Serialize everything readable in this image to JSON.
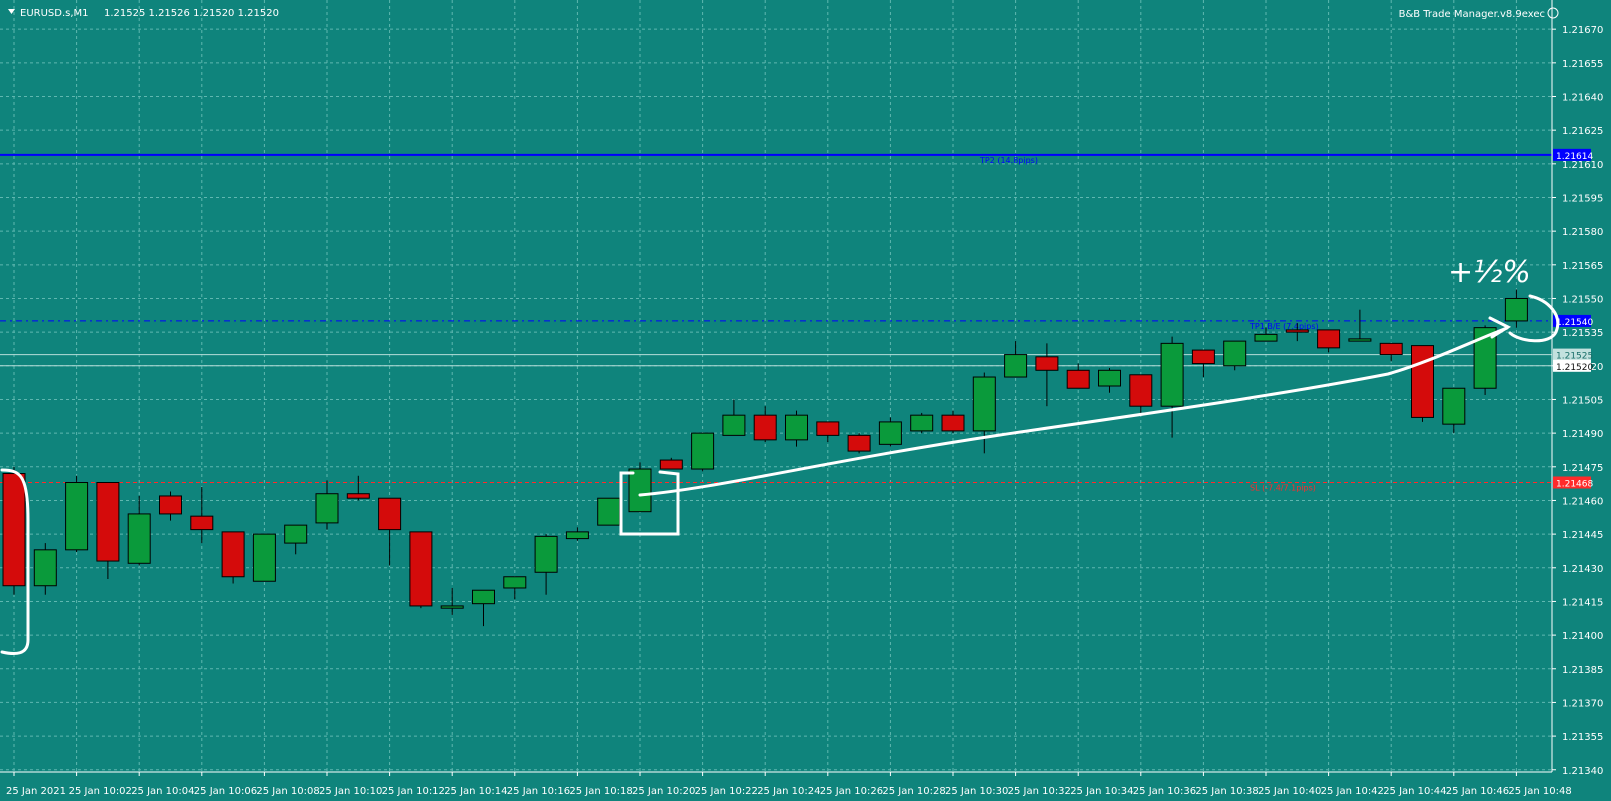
{
  "header": {
    "symbol": "EURUSD.s,M1",
    "ohlc": "1.21525 1.21526 1.21520 1.21520",
    "indicator": "B&B Trade Manager.v8.9exec"
  },
  "annotation": {
    "text": "+½%"
  },
  "colors": {
    "background": "#0f847c",
    "grid": "#5fb7b0",
    "bull": "#0a9a3b",
    "bear": "#d40b0b",
    "tp": "#0000ff",
    "sl": "#ff2a2a",
    "ink": "#ffffff"
  },
  "chart_data": {
    "type": "candlestick",
    "title": "",
    "xlabel": "",
    "ylabel": "",
    "ylim": [
      1.21339,
      1.21683
    ],
    "y_ticks": [
      "1.21670",
      "1.21655",
      "1.21640",
      "1.21625",
      "1.21610",
      "1.21595",
      "1.21580",
      "1.21565",
      "1.21550",
      "1.21535",
      "1.21520",
      "1.21505",
      "1.21490",
      "1.21475",
      "1.21460",
      "1.21445",
      "1.21430",
      "1.21415",
      "1.21400",
      "1.21385",
      "1.21370",
      "1.21355",
      "1.21340"
    ],
    "x_ticks": [
      {
        "i": 0,
        "label": "25 Jan 2021"
      },
      {
        "i": 2,
        "label": "25 Jan 10:02"
      },
      {
        "i": 4,
        "label": "25 Jan 10:04"
      },
      {
        "i": 6,
        "label": "25 Jan 10:06"
      },
      {
        "i": 8,
        "label": "25 Jan 10:08"
      },
      {
        "i": 10,
        "label": "25 Jan 10:10"
      },
      {
        "i": 12,
        "label": "25 Jan 10:12"
      },
      {
        "i": 14,
        "label": "25 Jan 10:14"
      },
      {
        "i": 16,
        "label": "25 Jan 10:16"
      },
      {
        "i": 18,
        "label": "25 Jan 10:18"
      },
      {
        "i": 20,
        "label": "25 Jan 10:20"
      },
      {
        "i": 22,
        "label": "25 Jan 10:22"
      },
      {
        "i": 24,
        "label": "25 Jan 10:24"
      },
      {
        "i": 26,
        "label": "25 Jan 10:26"
      },
      {
        "i": 28,
        "label": "25 Jan 10:28"
      },
      {
        "i": 30,
        "label": "25 Jan 10:30"
      },
      {
        "i": 32,
        "label": "25 Jan 10:32"
      },
      {
        "i": 34,
        "label": "25 Jan 10:34"
      },
      {
        "i": 36,
        "label": "25 Jan 10:36"
      },
      {
        "i": 38,
        "label": "25 Jan 10:38"
      },
      {
        "i": 40,
        "label": "25 Jan 10:40"
      },
      {
        "i": 42,
        "label": "25 Jan 10:42"
      },
      {
        "i": 44,
        "label": "25 Jan 10:44"
      },
      {
        "i": 46,
        "label": "25 Jan 10:46"
      },
      {
        "i": 48,
        "label": "25 Jan 10:48"
      }
    ],
    "candles": [
      {
        "o": 1.21472,
        "h": 1.21475,
        "l": 1.21418,
        "c": 1.21422
      },
      {
        "o": 1.21422,
        "h": 1.21441,
        "l": 1.21418,
        "c": 1.21438
      },
      {
        "o": 1.21438,
        "h": 1.21471,
        "l": 1.21437,
        "c": 1.21468
      },
      {
        "o": 1.21468,
        "h": 1.21468,
        "l": 1.21425,
        "c": 1.21433
      },
      {
        "o": 1.21432,
        "h": 1.21462,
        "l": 1.21431,
        "c": 1.21454
      },
      {
        "o": 1.21462,
        "h": 1.21464,
        "l": 1.21451,
        "c": 1.21454
      },
      {
        "o": 1.21453,
        "h": 1.21466,
        "l": 1.21441,
        "c": 1.21447
      },
      {
        "o": 1.21446,
        "h": 1.21446,
        "l": 1.21423,
        "c": 1.21426
      },
      {
        "o": 1.21424,
        "h": 1.21445,
        "l": 1.21424,
        "c": 1.21445
      },
      {
        "o": 1.21441,
        "h": 1.21448,
        "l": 1.21436,
        "c": 1.21449
      },
      {
        "o": 1.2145,
        "h": 1.21469,
        "l": 1.21447,
        "c": 1.21463
      },
      {
        "o": 1.21463,
        "h": 1.21471,
        "l": 1.2146,
        "c": 1.21461
      },
      {
        "o": 1.21461,
        "h": 1.21461,
        "l": 1.21431,
        "c": 1.21447
      },
      {
        "o": 1.21446,
        "h": 1.21446,
        "l": 1.21412,
        "c": 1.21413
      },
      {
        "o": 1.21412,
        "h": 1.21421,
        "l": 1.21409,
        "c": 1.21413
      },
      {
        "o": 1.21414,
        "h": 1.2142,
        "l": 1.21404,
        "c": 1.2142
      },
      {
        "o": 1.21421,
        "h": 1.21426,
        "l": 1.21416,
        "c": 1.21426
      },
      {
        "o": 1.21428,
        "h": 1.21445,
        "l": 1.21418,
        "c": 1.21444
      },
      {
        "o": 1.21443,
        "h": 1.21448,
        "l": 1.21442,
        "c": 1.21446
      },
      {
        "o": 1.21449,
        "h": 1.21457,
        "l": 1.21449,
        "c": 1.21461
      },
      {
        "o": 1.21455,
        "h": 1.21477,
        "l": 1.21455,
        "c": 1.21474
      },
      {
        "o": 1.21478,
        "h": 1.21479,
        "l": 1.21474,
        "c": 1.21474
      },
      {
        "o": 1.21474,
        "h": 1.21489,
        "l": 1.21473,
        "c": 1.2149
      },
      {
        "o": 1.21489,
        "h": 1.21505,
        "l": 1.21489,
        "c": 1.21498
      },
      {
        "o": 1.21498,
        "h": 1.21502,
        "l": 1.21486,
        "c": 1.21487
      },
      {
        "o": 1.21487,
        "h": 1.215,
        "l": 1.21484,
        "c": 1.21498
      },
      {
        "o": 1.21495,
        "h": 1.21495,
        "l": 1.21486,
        "c": 1.21489
      },
      {
        "o": 1.21489,
        "h": 1.2149,
        "l": 1.21481,
        "c": 1.21482
      },
      {
        "o": 1.21485,
        "h": 1.21497,
        "l": 1.21484,
        "c": 1.21495
      },
      {
        "o": 1.21491,
        "h": 1.21499,
        "l": 1.2149,
        "c": 1.21498
      },
      {
        "o": 1.21498,
        "h": 1.215,
        "l": 1.2149,
        "c": 1.21491
      },
      {
        "o": 1.21491,
        "h": 1.21517,
        "l": 1.21481,
        "c": 1.21515
      },
      {
        "o": 1.21515,
        "h": 1.21531,
        "l": 1.21515,
        "c": 1.21525
      },
      {
        "o": 1.21524,
        "h": 1.2153,
        "l": 1.21502,
        "c": 1.21518
      },
      {
        "o": 1.21518,
        "h": 1.21521,
        "l": 1.2151,
        "c": 1.2151
      },
      {
        "o": 1.21511,
        "h": 1.21519,
        "l": 1.21508,
        "c": 1.21518
      },
      {
        "o": 1.21516,
        "h": 1.21516,
        "l": 1.21498,
        "c": 1.21502
      },
      {
        "o": 1.21502,
        "h": 1.21533,
        "l": 1.21488,
        "c": 1.2153
      },
      {
        "o": 1.21527,
        "h": 1.21527,
        "l": 1.21515,
        "c": 1.21521
      },
      {
        "o": 1.2152,
        "h": 1.21531,
        "l": 1.21518,
        "c": 1.21531
      },
      {
        "o": 1.21531,
        "h": 1.21537,
        "l": 1.21531,
        "c": 1.21534
      },
      {
        "o": 1.21536,
        "h": 1.21539,
        "l": 1.21531,
        "c": 1.21535
      },
      {
        "o": 1.21536,
        "h": 1.21536,
        "l": 1.21526,
        "c": 1.21528
      },
      {
        "o": 1.21531,
        "h": 1.21545,
        "l": 1.21531,
        "c": 1.21532
      },
      {
        "o": 1.2153,
        "h": 1.2153,
        "l": 1.21522,
        "c": 1.21525
      },
      {
        "o": 1.21529,
        "h": 1.21529,
        "l": 1.21495,
        "c": 1.21497
      },
      {
        "o": 1.21494,
        "h": 1.21509,
        "l": 1.2149,
        "c": 1.2151
      },
      {
        "o": 1.2151,
        "h": 1.21538,
        "l": 1.21507,
        "c": 1.21537
      },
      {
        "o": 1.2154,
        "h": 1.21554,
        "l": 1.21537,
        "c": 1.2155
      }
    ],
    "levels": [
      {
        "name": "tp2",
        "price": 1.21614,
        "label": "TP2 (14.8pips)",
        "price_label": "1.21614"
      },
      {
        "name": "tp1",
        "price": 1.2154,
        "label": "TP1 B/E (7.4pips)",
        "price_label": "1.21540"
      },
      {
        "name": "sl",
        "price": 1.21468,
        "label": "SL (-7.4/7.1pips)",
        "price_label": "1.21468"
      },
      {
        "name": "ask",
        "price": 1.21525,
        "label": "",
        "price_label": "1.21525"
      },
      {
        "name": "bid",
        "price": 1.2152,
        "label": "",
        "price_label": "1.21520"
      }
    ]
  }
}
